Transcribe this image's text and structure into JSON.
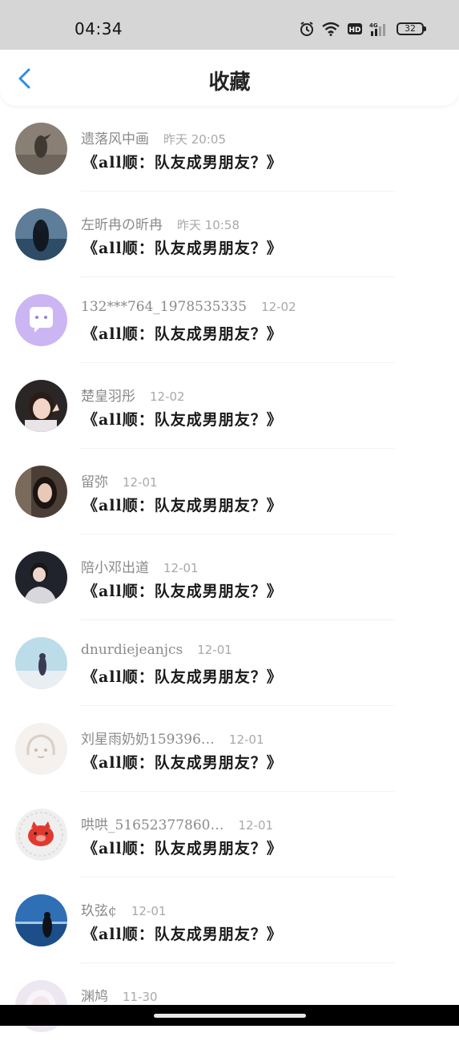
{
  "status_bar": {
    "time": "04:34",
    "battery": "32"
  },
  "header": {
    "title": "收藏"
  },
  "items": [
    {
      "name": "遗落风中画",
      "time": "昨天 20:05",
      "title": "《all顺：队友成男朋友？》",
      "avatar": "photo-figure"
    },
    {
      "name": "左昕冉の昕冉",
      "time": "昨天 10:58",
      "title": "《all顺：队友成男朋友？》",
      "avatar": "photo-sea-girl"
    },
    {
      "name": "132***764_1978535335",
      "time": "12-02",
      "title": "《all顺：队友成男朋友？》",
      "avatar": "default-chat-bubble"
    },
    {
      "name": "楚皇羽彤",
      "time": "12-02",
      "title": "《all顺：队友成男朋友？》",
      "avatar": "photo-girl-peace"
    },
    {
      "name": "留弥",
      "time": "12-01",
      "title": "《all顺：队友成男朋友？》",
      "avatar": "photo-girl-indoor"
    },
    {
      "name": "陪小邓出道",
      "time": "12-01",
      "title": "《all顺：队友成男朋友？》",
      "avatar": "photo-boy-singing"
    },
    {
      "name": "dnurdiejeanjcs",
      "time": "12-01",
      "title": "《all顺：队友成男朋友？》",
      "avatar": "photo-girl-sky"
    },
    {
      "name": "刘星雨奶奶159396…",
      "time": "12-01",
      "title": "《all顺：队友成男朋友？》",
      "avatar": "sketch-girl"
    },
    {
      "name": "哄哄_51652377860…",
      "time": "12-01",
      "title": "《all顺：队友成男朋友？》",
      "avatar": "cartoon-red-pig"
    },
    {
      "name": "玖弦¢",
      "time": "12-01",
      "title": "《all顺：队友成男朋友？》",
      "avatar": "photo-person-sea"
    },
    {
      "name": "渊鸠",
      "time": "11-30",
      "title": "",
      "avatar": "anime-white-hair"
    }
  ],
  "colors": {
    "accent": "#2f8de4",
    "text_primary": "#1a1a1a",
    "text_secondary": "#8a8a8a"
  }
}
